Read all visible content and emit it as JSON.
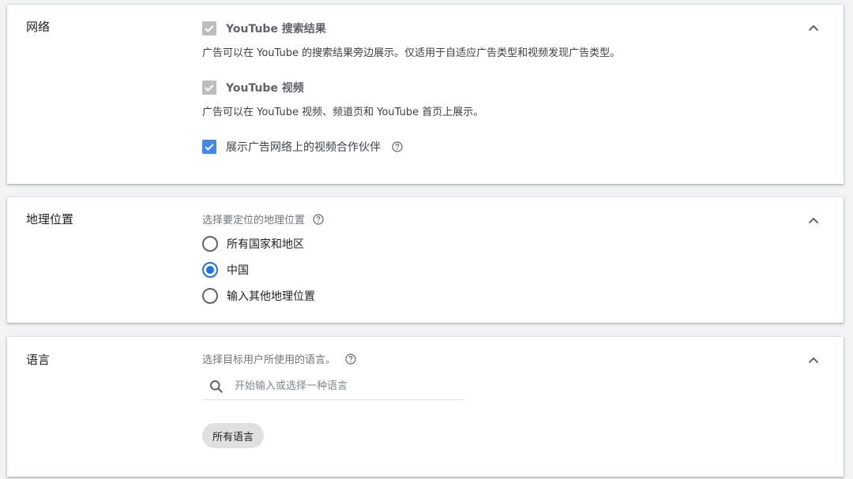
{
  "network": {
    "title": "网络",
    "youtube_search": {
      "label": "YouTube 搜索结果",
      "checked": true,
      "disabled": true,
      "description": "广告可以在 YouTube 的搜索结果旁边展示。仅适用于自适应广告类型和视频发现广告类型。"
    },
    "youtube_video": {
      "label": "YouTube 视频",
      "checked": true,
      "disabled": true,
      "description": "广告可以在 YouTube 视频、频道页和 YouTube 首页上展示。"
    },
    "display_partners": {
      "label": "展示广告网络上的视频合作伙伴",
      "checked": true
    }
  },
  "location": {
    "title": "地理位置",
    "hint": "选择要定位的地理位置",
    "options": [
      {
        "label": "所有国家和地区",
        "selected": false
      },
      {
        "label": "中国",
        "selected": true
      },
      {
        "label": "输入其他地理位置",
        "selected": false
      }
    ]
  },
  "language": {
    "title": "语言",
    "hint": "选择目标用户所使用的语言。",
    "search_placeholder": "开始输入或选择一种语言",
    "search_value": "",
    "chip_label": "所有语言"
  },
  "colors": {
    "accent": "#1a73e8",
    "checkbox_active": "#4285f4",
    "checkbox_disabled": "#bdbdbd",
    "chip_bg": "#e0e0e0"
  },
  "icons": {
    "collapse": "chevron-up-icon",
    "help": "help-circle-icon",
    "search": "search-icon",
    "check": "check-icon"
  }
}
